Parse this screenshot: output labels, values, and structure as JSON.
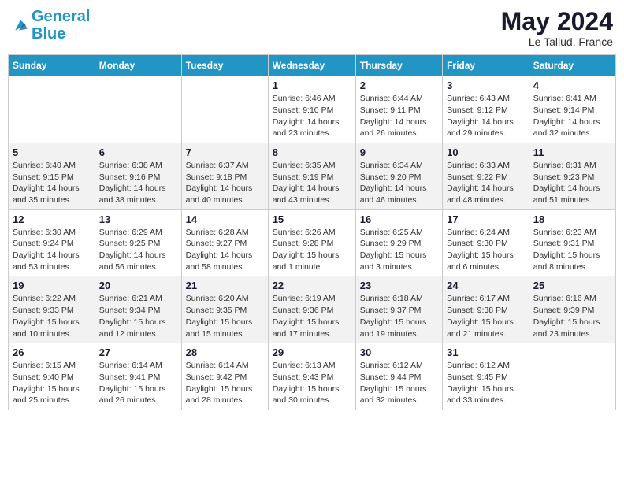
{
  "header": {
    "logo_line1": "General",
    "logo_line2": "Blue",
    "month": "May 2024",
    "location": "Le Tallud, France"
  },
  "weekdays": [
    "Sunday",
    "Monday",
    "Tuesday",
    "Wednesday",
    "Thursday",
    "Friday",
    "Saturday"
  ],
  "weeks": [
    [
      {
        "day": "",
        "info": ""
      },
      {
        "day": "",
        "info": ""
      },
      {
        "day": "",
        "info": ""
      },
      {
        "day": "1",
        "info": "Sunrise: 6:46 AM\nSunset: 9:10 PM\nDaylight: 14 hours and 23 minutes."
      },
      {
        "day": "2",
        "info": "Sunrise: 6:44 AM\nSunset: 9:11 PM\nDaylight: 14 hours and 26 minutes."
      },
      {
        "day": "3",
        "info": "Sunrise: 6:43 AM\nSunset: 9:12 PM\nDaylight: 14 hours and 29 minutes."
      },
      {
        "day": "4",
        "info": "Sunrise: 6:41 AM\nSunset: 9:14 PM\nDaylight: 14 hours and 32 minutes."
      }
    ],
    [
      {
        "day": "5",
        "info": "Sunrise: 6:40 AM\nSunset: 9:15 PM\nDaylight: 14 hours and 35 minutes."
      },
      {
        "day": "6",
        "info": "Sunrise: 6:38 AM\nSunset: 9:16 PM\nDaylight: 14 hours and 38 minutes."
      },
      {
        "day": "7",
        "info": "Sunrise: 6:37 AM\nSunset: 9:18 PM\nDaylight: 14 hours and 40 minutes."
      },
      {
        "day": "8",
        "info": "Sunrise: 6:35 AM\nSunset: 9:19 PM\nDaylight: 14 hours and 43 minutes."
      },
      {
        "day": "9",
        "info": "Sunrise: 6:34 AM\nSunset: 9:20 PM\nDaylight: 14 hours and 46 minutes."
      },
      {
        "day": "10",
        "info": "Sunrise: 6:33 AM\nSunset: 9:22 PM\nDaylight: 14 hours and 48 minutes."
      },
      {
        "day": "11",
        "info": "Sunrise: 6:31 AM\nSunset: 9:23 PM\nDaylight: 14 hours and 51 minutes."
      }
    ],
    [
      {
        "day": "12",
        "info": "Sunrise: 6:30 AM\nSunset: 9:24 PM\nDaylight: 14 hours and 53 minutes."
      },
      {
        "day": "13",
        "info": "Sunrise: 6:29 AM\nSunset: 9:25 PM\nDaylight: 14 hours and 56 minutes."
      },
      {
        "day": "14",
        "info": "Sunrise: 6:28 AM\nSunset: 9:27 PM\nDaylight: 14 hours and 58 minutes."
      },
      {
        "day": "15",
        "info": "Sunrise: 6:26 AM\nSunset: 9:28 PM\nDaylight: 15 hours and 1 minute."
      },
      {
        "day": "16",
        "info": "Sunrise: 6:25 AM\nSunset: 9:29 PM\nDaylight: 15 hours and 3 minutes."
      },
      {
        "day": "17",
        "info": "Sunrise: 6:24 AM\nSunset: 9:30 PM\nDaylight: 15 hours and 6 minutes."
      },
      {
        "day": "18",
        "info": "Sunrise: 6:23 AM\nSunset: 9:31 PM\nDaylight: 15 hours and 8 minutes."
      }
    ],
    [
      {
        "day": "19",
        "info": "Sunrise: 6:22 AM\nSunset: 9:33 PM\nDaylight: 15 hours and 10 minutes."
      },
      {
        "day": "20",
        "info": "Sunrise: 6:21 AM\nSunset: 9:34 PM\nDaylight: 15 hours and 12 minutes."
      },
      {
        "day": "21",
        "info": "Sunrise: 6:20 AM\nSunset: 9:35 PM\nDaylight: 15 hours and 15 minutes."
      },
      {
        "day": "22",
        "info": "Sunrise: 6:19 AM\nSunset: 9:36 PM\nDaylight: 15 hours and 17 minutes."
      },
      {
        "day": "23",
        "info": "Sunrise: 6:18 AM\nSunset: 9:37 PM\nDaylight: 15 hours and 19 minutes."
      },
      {
        "day": "24",
        "info": "Sunrise: 6:17 AM\nSunset: 9:38 PM\nDaylight: 15 hours and 21 minutes."
      },
      {
        "day": "25",
        "info": "Sunrise: 6:16 AM\nSunset: 9:39 PM\nDaylight: 15 hours and 23 minutes."
      }
    ],
    [
      {
        "day": "26",
        "info": "Sunrise: 6:15 AM\nSunset: 9:40 PM\nDaylight: 15 hours and 25 minutes."
      },
      {
        "day": "27",
        "info": "Sunrise: 6:14 AM\nSunset: 9:41 PM\nDaylight: 15 hours and 26 minutes."
      },
      {
        "day": "28",
        "info": "Sunrise: 6:14 AM\nSunset: 9:42 PM\nDaylight: 15 hours and 28 minutes."
      },
      {
        "day": "29",
        "info": "Sunrise: 6:13 AM\nSunset: 9:43 PM\nDaylight: 15 hours and 30 minutes."
      },
      {
        "day": "30",
        "info": "Sunrise: 6:12 AM\nSunset: 9:44 PM\nDaylight: 15 hours and 32 minutes."
      },
      {
        "day": "31",
        "info": "Sunrise: 6:12 AM\nSunset: 9:45 PM\nDaylight: 15 hours and 33 minutes."
      },
      {
        "day": "",
        "info": ""
      }
    ]
  ]
}
